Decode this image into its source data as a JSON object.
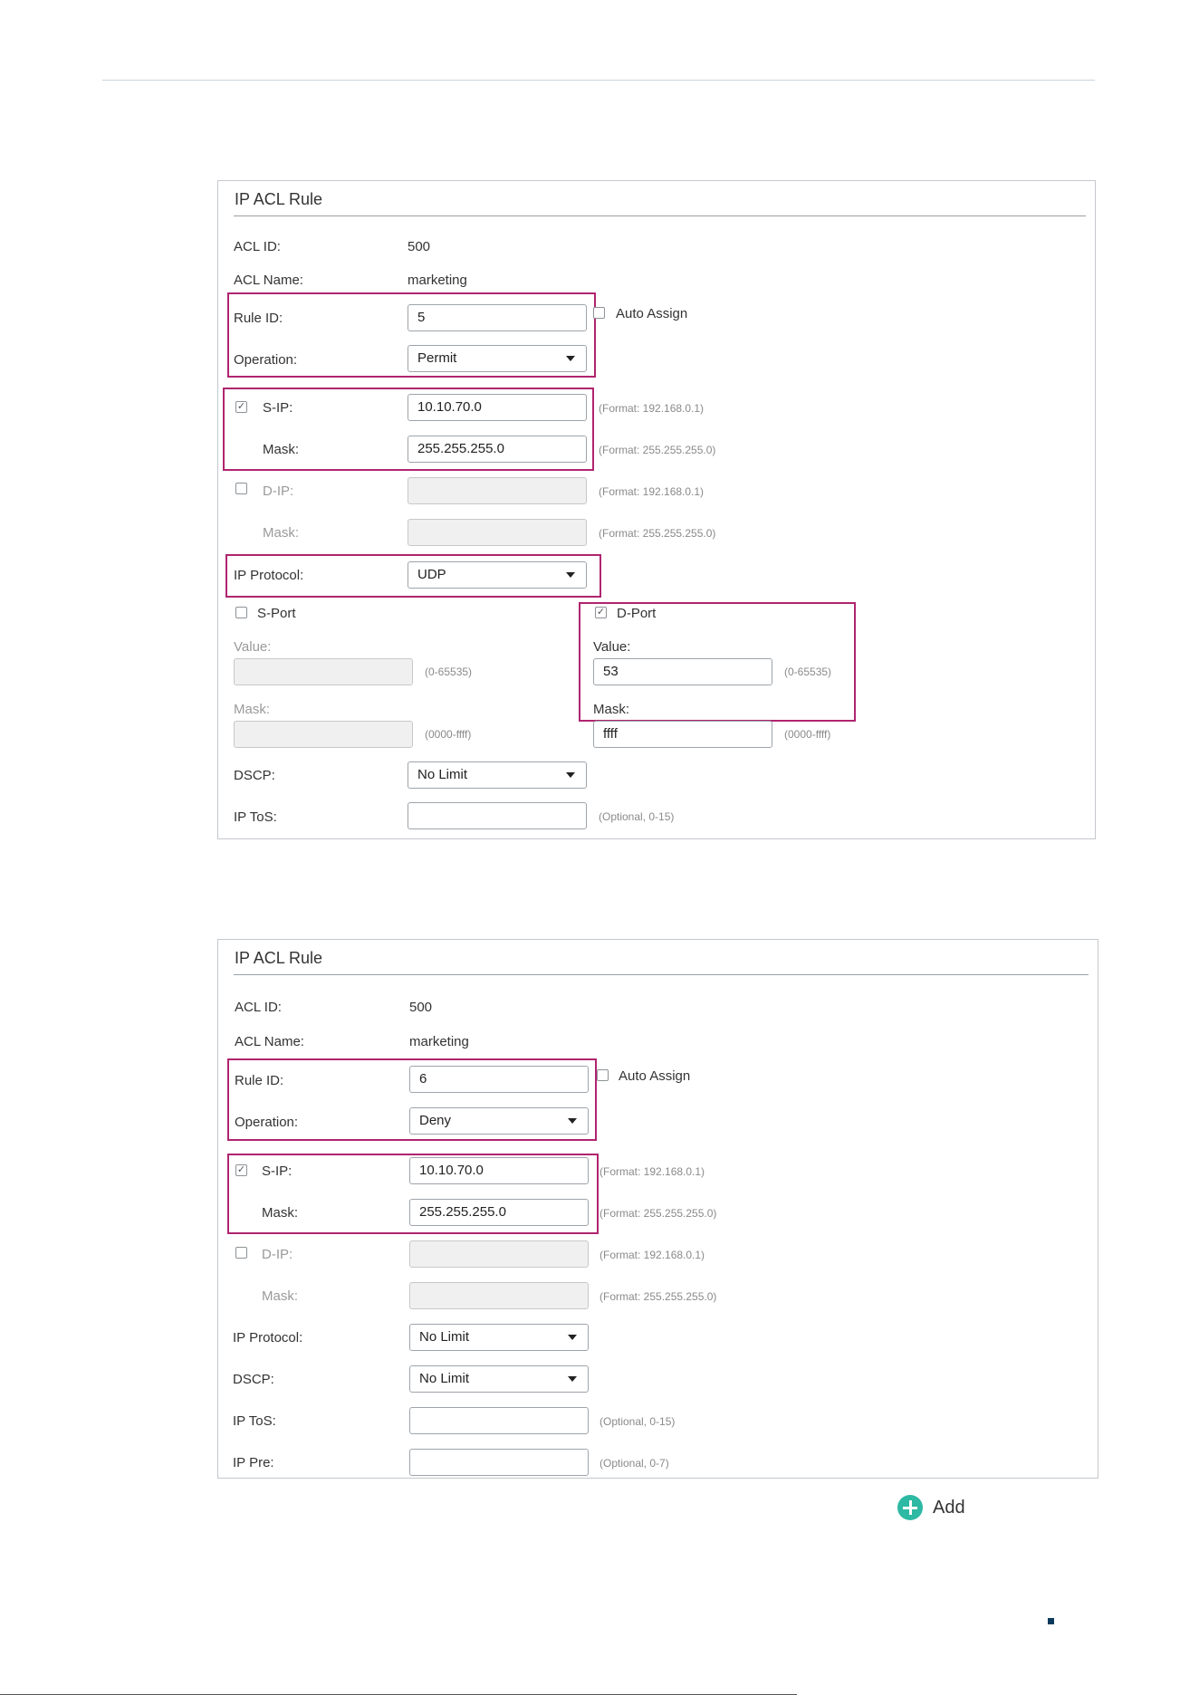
{
  "panel1": {
    "title": "IP ACL Rule",
    "acl_id_label": "ACL ID:",
    "acl_id_value": "500",
    "acl_name_label": "ACL Name:",
    "acl_name_value": "marketing",
    "rule_id_label": "Rule ID:",
    "rule_id_value": "5",
    "auto_assign_label": "Auto Assign",
    "operation_label": "Operation:",
    "operation_value": "Permit",
    "sip_label": "S-IP:",
    "sip_value": "10.10.70.0",
    "sip_hint": "(Format: 192.168.0.1)",
    "sip_mask_label": "Mask:",
    "sip_mask_value": "255.255.255.0",
    "sip_mask_hint": "(Format: 255.255.255.0)",
    "dip_label": "D-IP:",
    "dip_hint": "(Format: 192.168.0.1)",
    "dip_mask_label": "Mask:",
    "dip_mask_hint": "(Format: 255.255.255.0)",
    "protocol_label": "IP Protocol:",
    "protocol_value": "UDP",
    "sport_label": "S-Port",
    "sport_value_label": "Value:",
    "sport_value_hint": "(0-65535)",
    "sport_mask_label": "Mask:",
    "sport_mask_hint": "(0000-ffff)",
    "dport_label": "D-Port",
    "dport_value_label": "Value:",
    "dport_value": "53",
    "dport_value_hint": "(0-65535)",
    "dport_mask_label": "Mask:",
    "dport_mask_value": "ffff",
    "dport_mask_hint": "(0000-ffff)",
    "dscp_label": "DSCP:",
    "dscp_value": "No Limit",
    "tos_label": "IP ToS:",
    "tos_hint": "(Optional, 0-15)"
  },
  "panel2": {
    "title": "IP ACL Rule",
    "acl_id_label": "ACL ID:",
    "acl_id_value": "500",
    "acl_name_label": "ACL Name:",
    "acl_name_value": "marketing",
    "rule_id_label": "Rule ID:",
    "rule_id_value": "6",
    "auto_assign_label": "Auto Assign",
    "operation_label": "Operation:",
    "operation_value": "Deny",
    "sip_label": "S-IP:",
    "sip_value": "10.10.70.0",
    "sip_hint": "(Format: 192.168.0.1)",
    "sip_mask_label": "Mask:",
    "sip_mask_value": "255.255.255.0",
    "sip_mask_hint": "(Format: 255.255.255.0)",
    "dip_label": "D-IP:",
    "dip_hint": "(Format: 192.168.0.1)",
    "dip_mask_label": "Mask:",
    "dip_mask_hint": "(Format: 255.255.255.0)",
    "protocol_label": "IP Protocol:",
    "protocol_value": "No Limit",
    "dscp_label": "DSCP:",
    "dscp_value": "No Limit",
    "tos_label": "IP ToS:",
    "tos_hint": "(Optional, 0-15)",
    "pre_label": "IP Pre:",
    "pre_hint": "(Optional, 0-7)"
  },
  "add_button": {
    "label": "Add",
    "icon": "plus-circle-icon",
    "color": "#2db9a3"
  },
  "colors": {
    "highlight": "#b0246f",
    "panel_border": "#c4c8cc"
  }
}
